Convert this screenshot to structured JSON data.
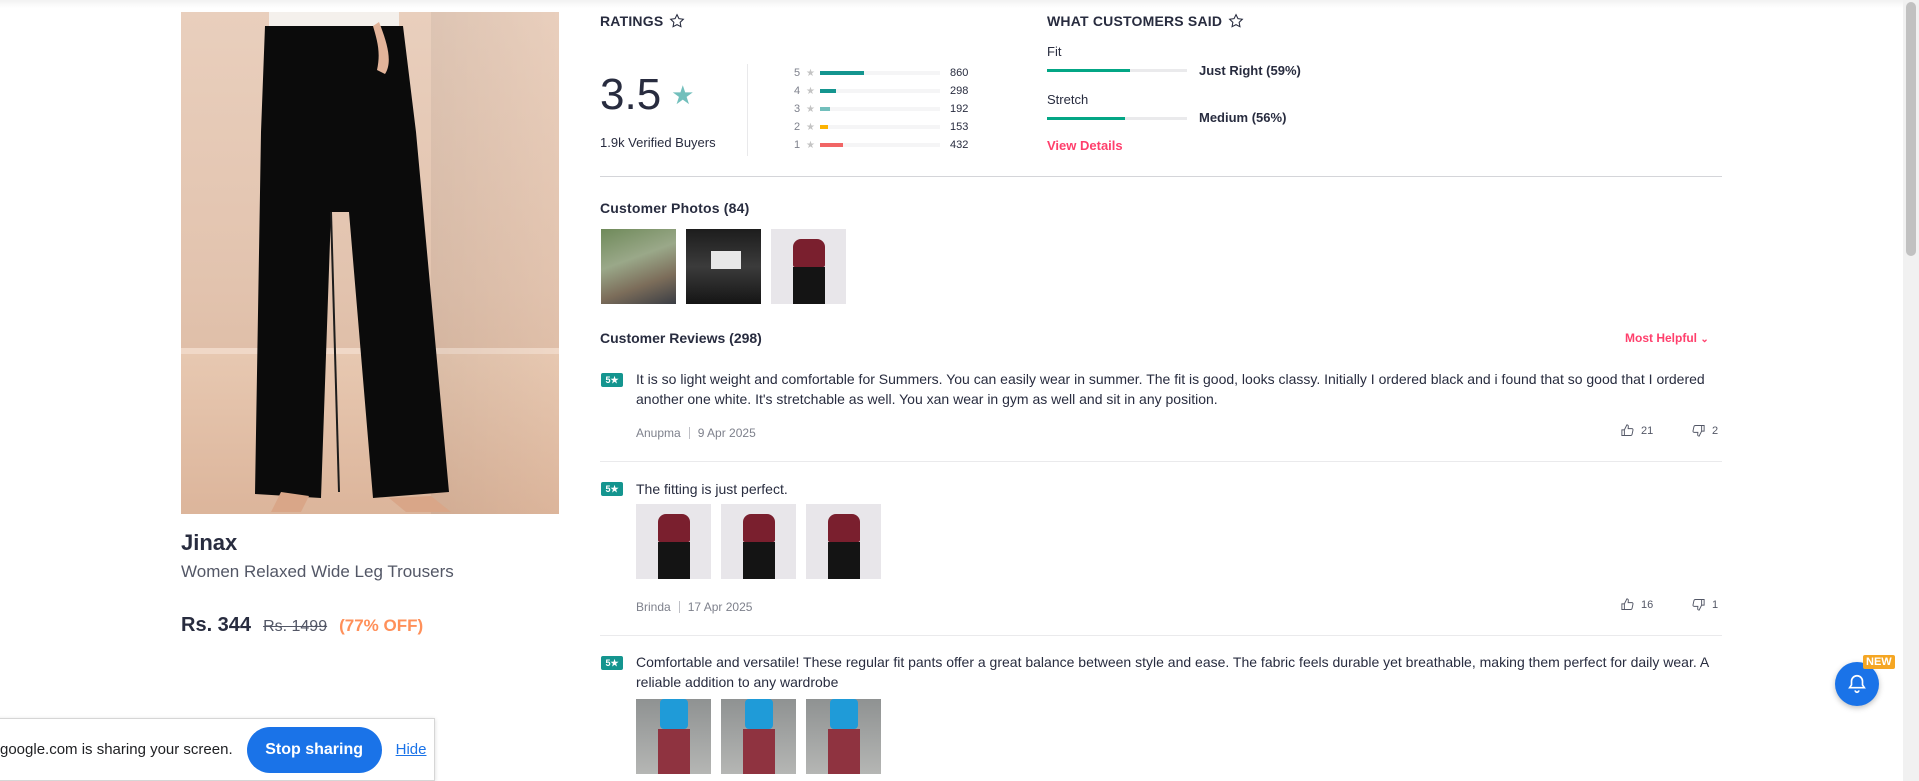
{
  "product": {
    "brand": "Jinax",
    "name": "Women Relaxed Wide Leg Trousers",
    "price": "Rs. 344",
    "mrp": "Rs. 1499",
    "discount": "(77% OFF)"
  },
  "ratings": {
    "title": "RATINGS",
    "average": "3.5",
    "verified": "1.9k Verified Buyers",
    "breakdown": [
      {
        "star": "5",
        "count": "860",
        "fraction": 0.37,
        "color": "#14958f"
      },
      {
        "star": "4",
        "count": "298",
        "fraction": 0.13,
        "color": "#14958f"
      },
      {
        "star": "3",
        "count": "192",
        "fraction": 0.08,
        "color": "#72bfbc"
      },
      {
        "star": "2",
        "count": "153",
        "fraction": 0.07,
        "color": "#fcb301"
      },
      {
        "star": "1",
        "count": "432",
        "fraction": 0.19,
        "color": "#f16565"
      }
    ]
  },
  "customers_said": {
    "title": "WHAT CUSTOMERS SAID",
    "fit_label": "Fit",
    "fit_value": "Just Right (59%)",
    "fit_fraction": 0.59,
    "stretch_label": "Stretch",
    "stretch_value": "Medium (56%)",
    "stretch_fraction": 0.56,
    "view_details": "View Details"
  },
  "photos": {
    "title": "Customer Photos (84)"
  },
  "reviews": {
    "title": "Customer Reviews (298)",
    "sort": "Most Helpful",
    "items": [
      {
        "rating": "5",
        "text": "It is so light weight and comfortable for Summers. You can easily wear in summer. The fit is good, looks classy. Initially I ordered black and i found that so good that I ordered another one white. It's stretchable as well. You xan wear in gym as well and sit in any position.",
        "author": "Anupma",
        "date": "9 Apr 2025",
        "likes": "21",
        "dislikes": "2"
      },
      {
        "rating": "5",
        "text": "The fitting is just perfect.",
        "author": "Brinda",
        "date": "17 Apr 2025",
        "likes": "16",
        "dislikes": "1"
      },
      {
        "rating": "5",
        "text": "Comfortable and versatile! These regular fit pants offer a great balance between style and ease. The fabric feels durable yet breathable, making them perfect for daily wear. A reliable addition to any wardrobe"
      }
    ]
  },
  "share_bar": {
    "message": "google.com is sharing your screen.",
    "stop": "Stop sharing",
    "hide": "Hide"
  },
  "notification": {
    "badge": "NEW"
  }
}
